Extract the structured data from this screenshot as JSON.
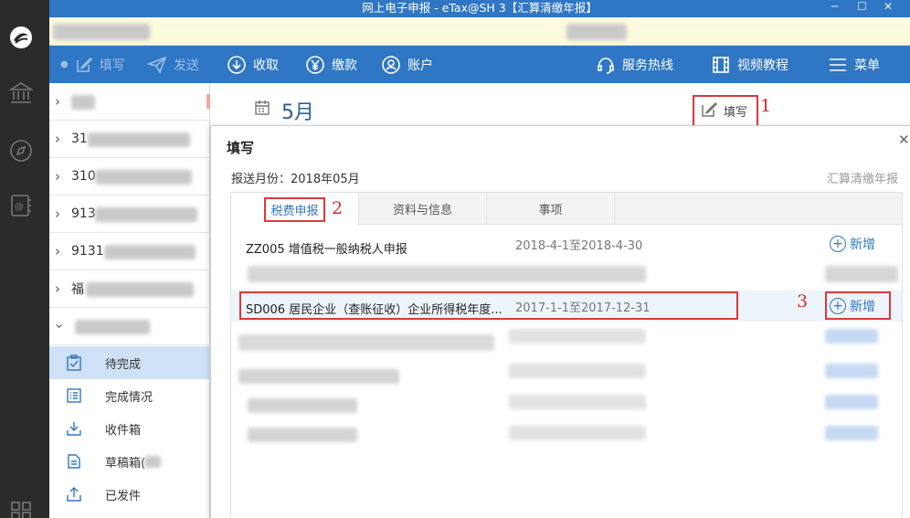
{
  "window": {
    "title": "网上电子申报 - eTax@SH 3【汇算清缴年报】"
  },
  "rail": {
    "icons": [
      "logo-icon",
      "tax-bureau-icon",
      "compass-icon",
      "contacts-icon",
      "grid-icon"
    ]
  },
  "toolbar": {
    "items": [
      {
        "label": "填写",
        "icon": "edit-icon",
        "enabled": false
      },
      {
        "label": "发送",
        "icon": "send-icon",
        "enabled": false
      },
      {
        "label": "收取",
        "icon": "download-icon",
        "enabled": true
      },
      {
        "label": "缴款",
        "icon": "yen-icon",
        "enabled": true
      },
      {
        "label": "账户",
        "icon": "user-icon",
        "enabled": true
      }
    ],
    "hotline_label": "服务热线",
    "video_label": "视频教程",
    "menu_label": "菜单"
  },
  "tree": {
    "companies": [
      {
        "label": "",
        "expanded": false
      },
      {
        "label": "31",
        "expanded": false
      },
      {
        "label": "310",
        "expanded": false
      },
      {
        "label": "913",
        "expanded": false
      },
      {
        "label": "9131",
        "expanded": false
      },
      {
        "label": "福",
        "expanded": false
      },
      {
        "label": "",
        "expanded": true
      }
    ],
    "subitems": [
      {
        "label": "待完成",
        "icon": "clipboard-check-icon",
        "active": true
      },
      {
        "label": "完成情况",
        "icon": "list-icon",
        "active": false
      },
      {
        "label": "收件箱",
        "icon": "inbox-icon",
        "active": false
      },
      {
        "label": "草稿箱(",
        "icon": "draft-icon",
        "active": false
      },
      {
        "label": "已发件",
        "icon": "upload-icon",
        "active": false
      }
    ]
  },
  "main": {
    "month": "5月",
    "fill_button": "填写",
    "annotation_1": "1"
  },
  "dialog": {
    "title": "填写",
    "month_label": "报送月份：",
    "month_value": "2018年05月",
    "kind": "汇算清缴年报",
    "tabs": [
      {
        "label": "税费申报",
        "active": true
      },
      {
        "label": "资料与信息",
        "active": false
      },
      {
        "label": "事项",
        "active": false
      }
    ],
    "annotation_2": "2",
    "annotation_3": "3",
    "rows": [
      {
        "code": "ZZ005  增值税一般纳税人申报",
        "period": "2018-4-1至2018-4-30",
        "add_label": "新增",
        "highlight": false
      },
      {
        "code": "SD006  居民企业（查账征收）企业所得税年度...",
        "period": "2017-1-1至2017-12-31",
        "add_label": "新增",
        "highlight": true
      }
    ]
  }
}
